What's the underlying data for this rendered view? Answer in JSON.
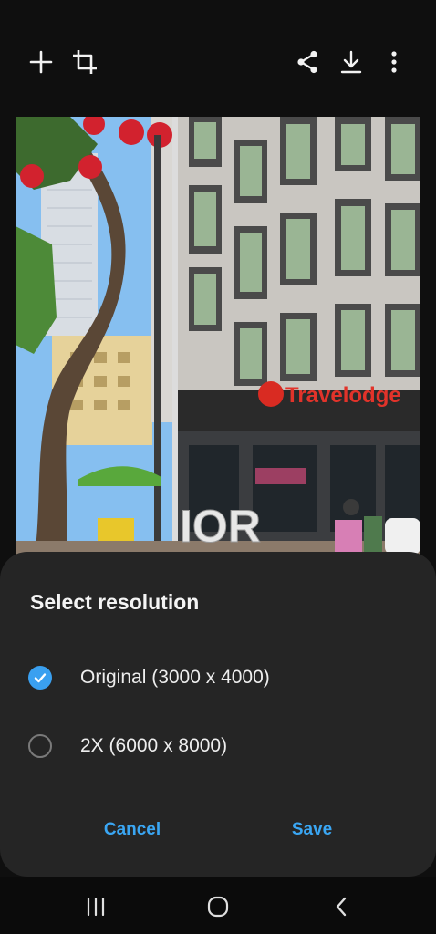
{
  "toolbar": {
    "left": [
      {
        "icon": "add-icon"
      },
      {
        "icon": "crop-icon"
      }
    ],
    "right": [
      {
        "icon": "share-icon"
      },
      {
        "icon": "download-icon"
      },
      {
        "icon": "more-options-icon"
      }
    ]
  },
  "photo": {
    "sign_text": "Travelodge",
    "letters_text": "IOR"
  },
  "dialog": {
    "title": "Select resolution",
    "options": [
      {
        "label": "Original (3000 x 4000)",
        "selected": true
      },
      {
        "label": "2X (6000 x 8000)",
        "selected": false
      }
    ],
    "cancel_label": "Cancel",
    "save_label": "Save",
    "accent_color": "#3aa6f3"
  },
  "navbar": {
    "items": [
      {
        "icon": "recent-apps-icon"
      },
      {
        "icon": "home-icon"
      },
      {
        "icon": "back-icon"
      }
    ]
  }
}
